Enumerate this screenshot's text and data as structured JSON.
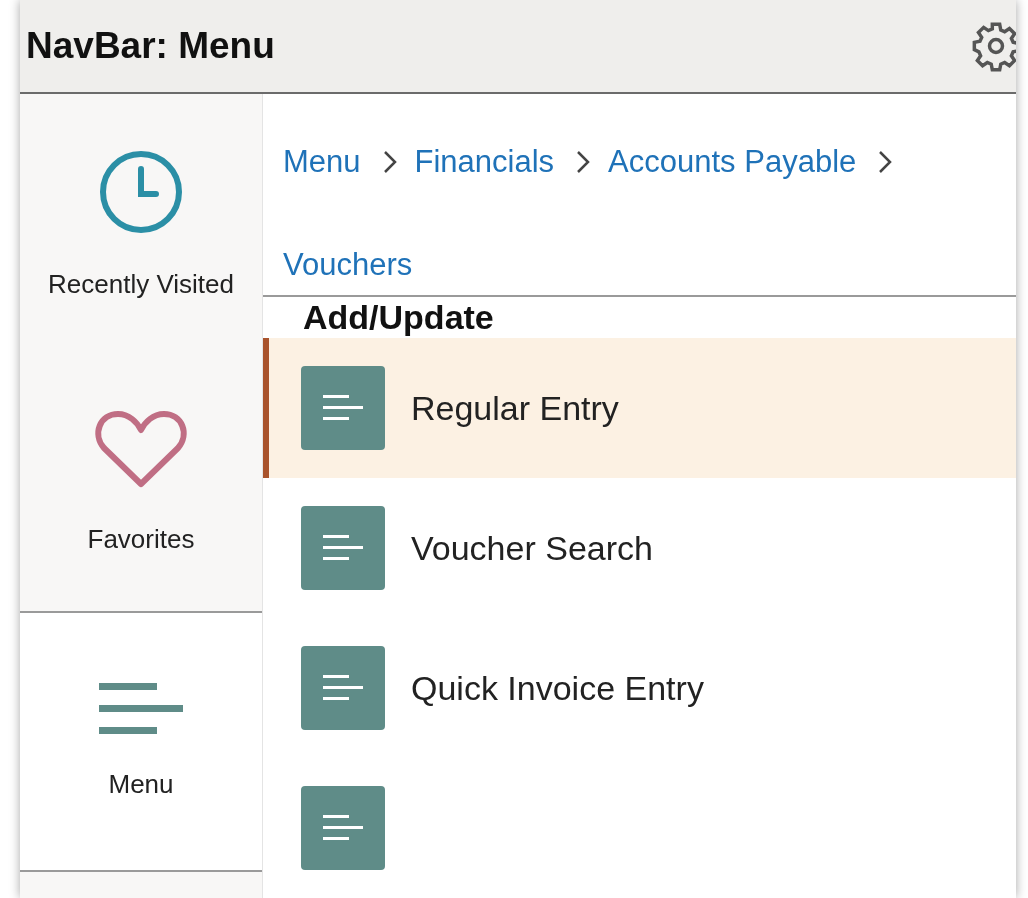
{
  "header": {
    "title": "NavBar: Menu"
  },
  "sidebar": {
    "items": [
      {
        "label": "Recently Visited",
        "kind": "clock",
        "selected": false
      },
      {
        "label": "Favorites",
        "kind": "heart",
        "selected": false
      },
      {
        "label": "Menu",
        "kind": "menu",
        "selected": true
      }
    ]
  },
  "breadcrumbs": [
    "Menu",
    "Financials",
    "Accounts Payable",
    "Vouchers"
  ],
  "section": {
    "title": "Add/Update",
    "items": [
      {
        "label": "Regular Entry",
        "selected": true
      },
      {
        "label": "Voucher Search",
        "selected": false
      },
      {
        "label": "Quick Invoice Entry",
        "selected": false
      },
      {
        "selected": false
      }
    ]
  }
}
